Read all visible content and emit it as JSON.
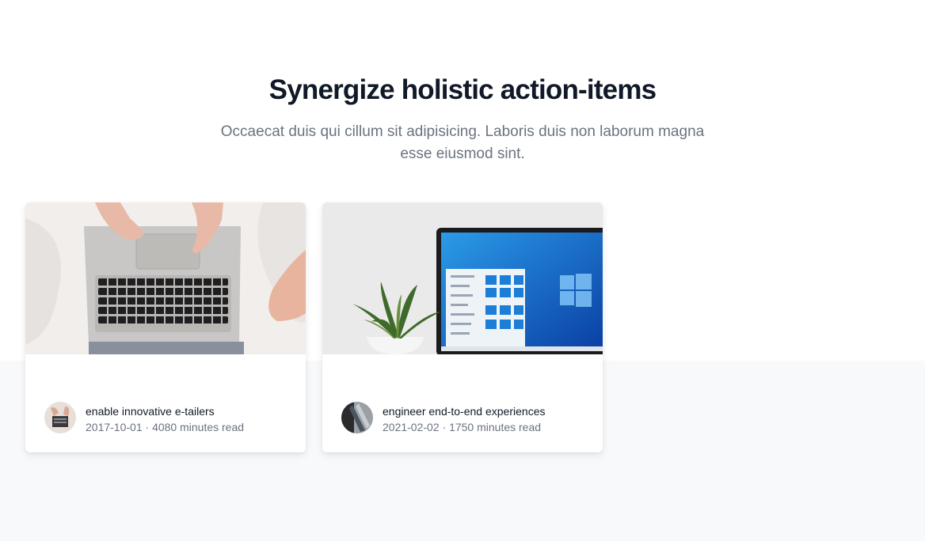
{
  "section": {
    "title": "Synergize holistic action-items",
    "subtitle": "Occaecat duis qui cillum sit adipisicing. Laboris duis non laborum magna esse eiusmod sint."
  },
  "cards": [
    {
      "title": "enable innovative e-tailers",
      "date": "2017-10-01",
      "separator": "·",
      "read_time": "4080 minutes read"
    },
    {
      "title": "engineer end-to-end experiences",
      "date": "2021-02-02",
      "separator": "·",
      "read_time": "1750 minutes read"
    }
  ],
  "colors": {
    "heading": "#111827",
    "muted": "#6b7280",
    "band": "#f8f9fb"
  }
}
